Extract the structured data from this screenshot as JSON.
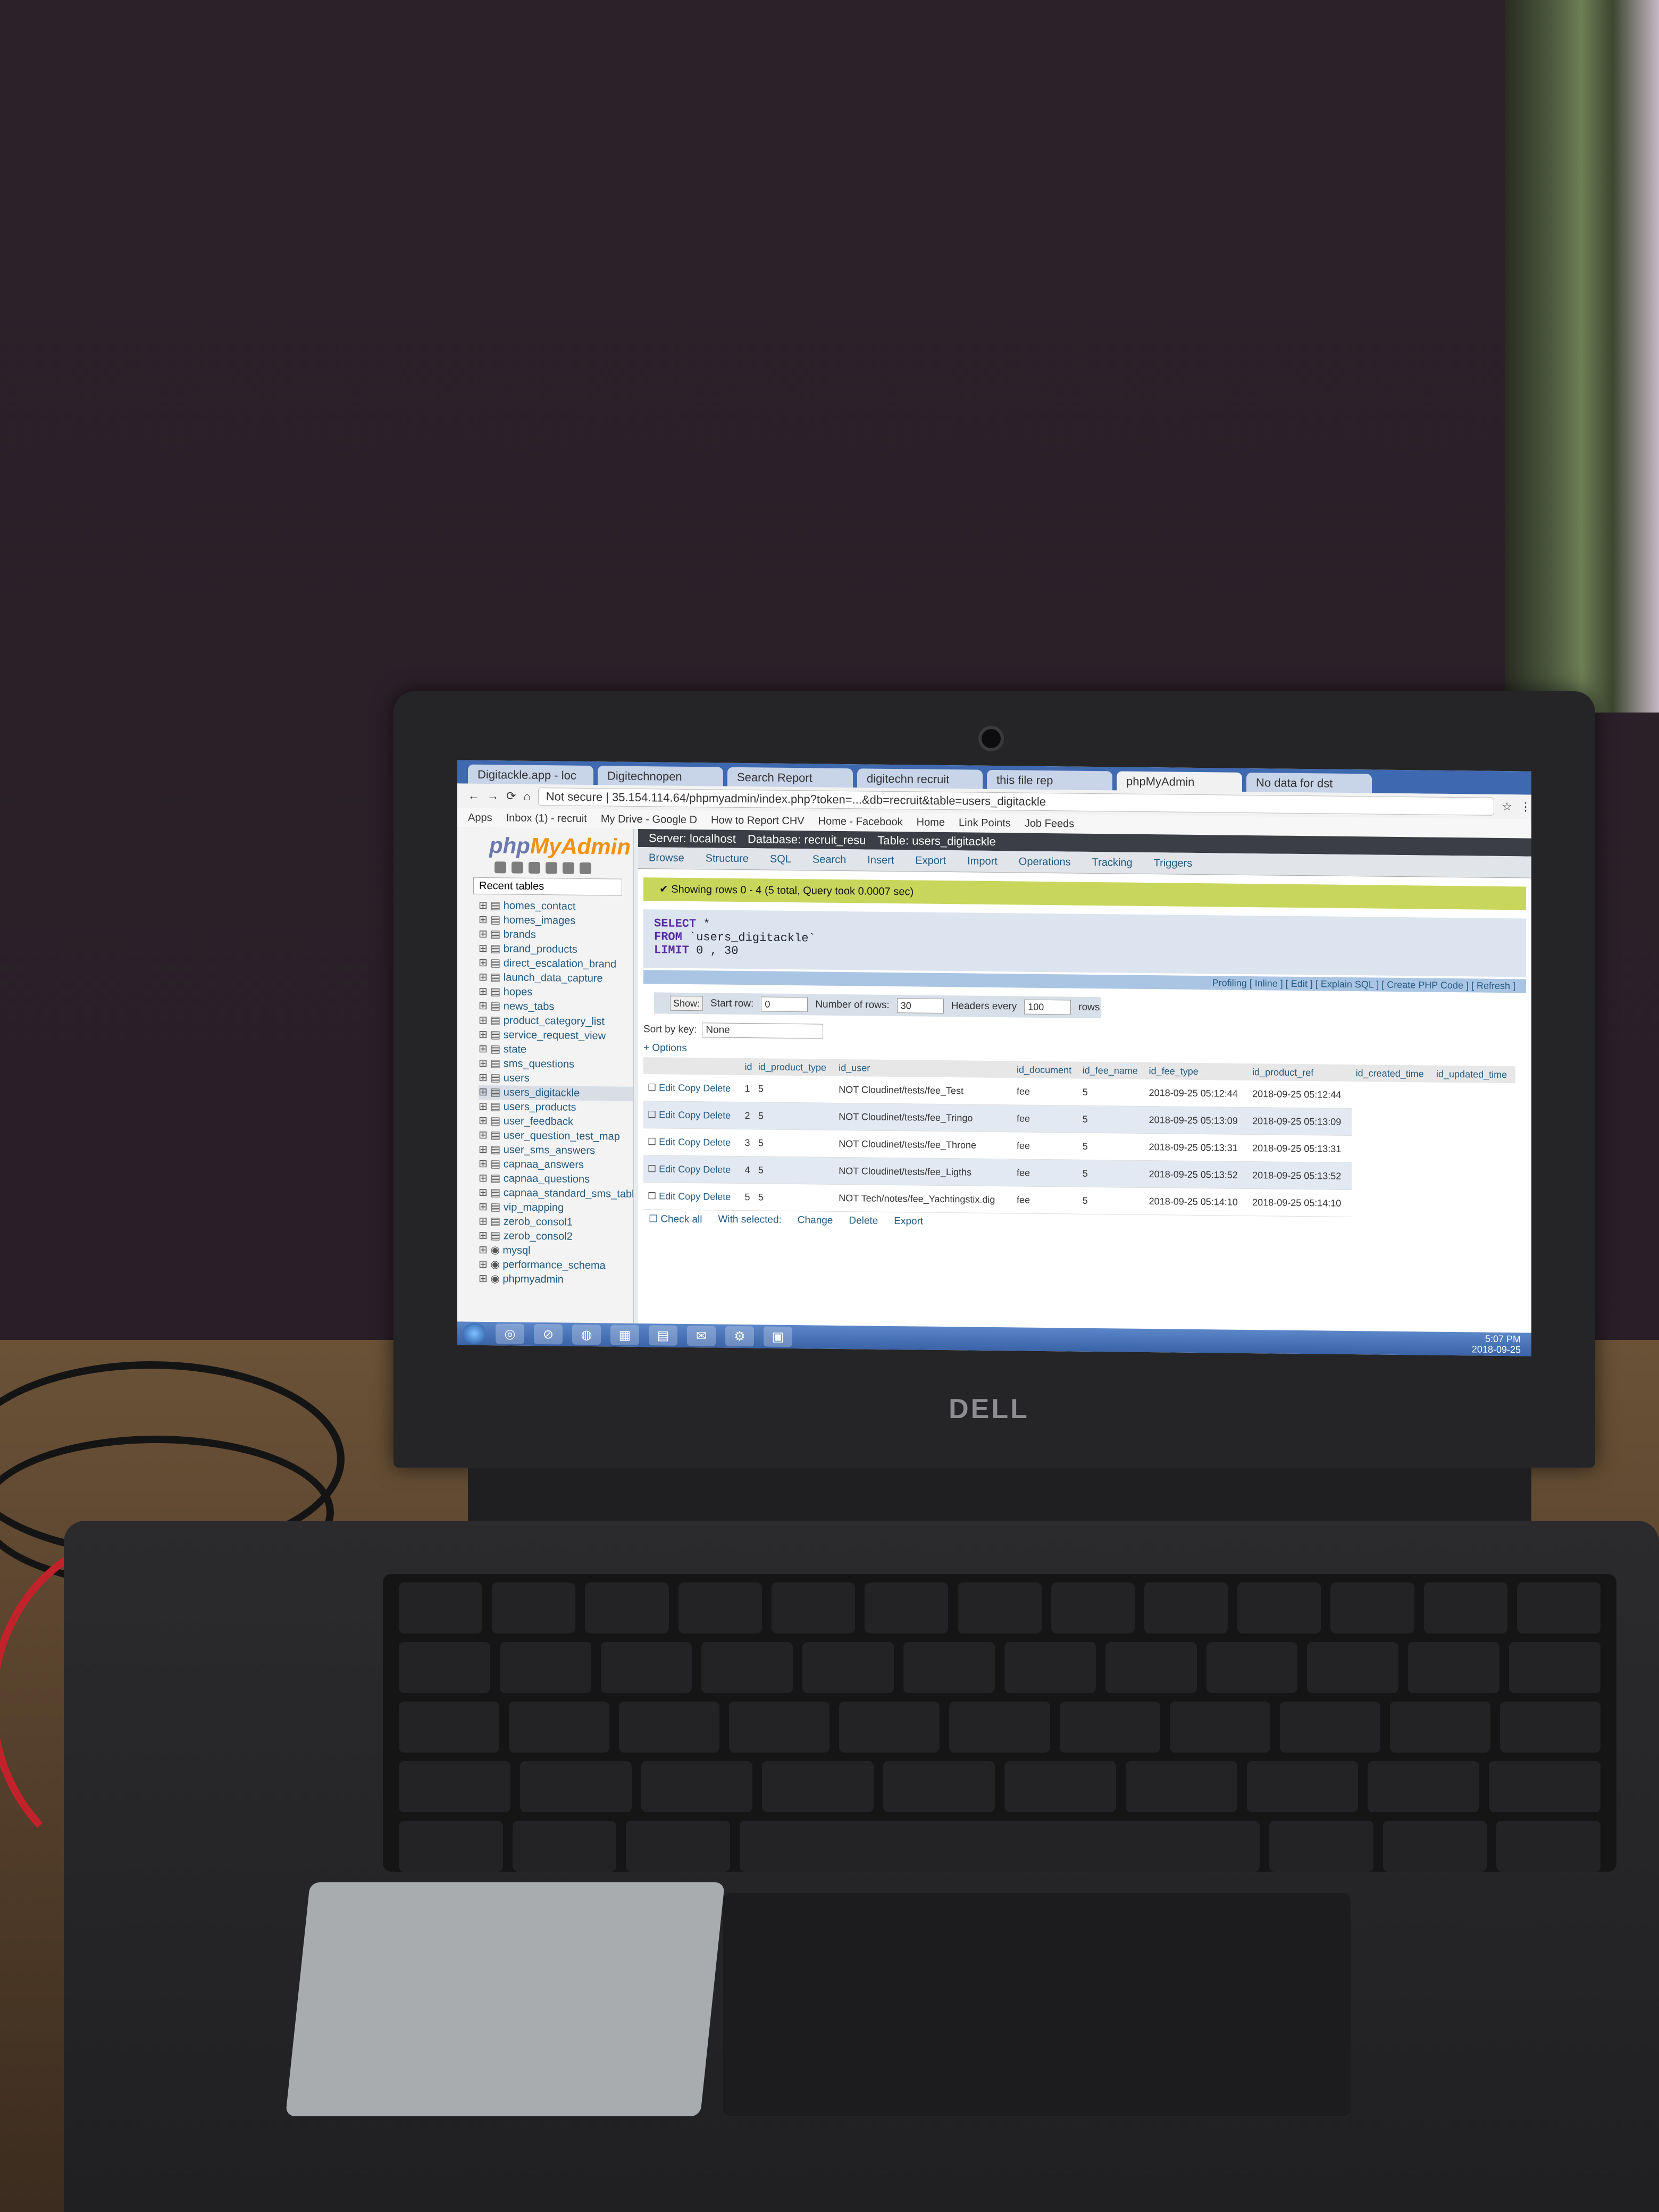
{
  "browser": {
    "tabs": [
      "Digitackle.app - loc",
      "Digitechnopen",
      "Search Report",
      "digitechn recruit",
      "this file rep",
      "phpMyAdmin",
      "No data for dst"
    ],
    "address": "Not secure | 35.154.114.64/phpmyadmin/index.php?token=...&db=recruit&table=users_digitackle",
    "bookmarks": [
      "Apps",
      "Inbox (1) - recruit",
      "My Drive - Google D",
      "How to Report CHV",
      "Home - Facebook",
      "Home",
      "Link Points",
      "Job Feeds"
    ]
  },
  "pma": {
    "logo_php": "php",
    "logo_my": "MyAdmin",
    "recent": "Recent tables",
    "tree": [
      "homes_contact",
      "homes_images",
      "brands",
      "brand_products",
      "direct_escalation_brand",
      "launch_data_capture",
      "hopes",
      "news_tabs",
      "product_category_list",
      "service_request_view",
      "state",
      "sms_questions",
      "users",
      "users_digitackle",
      "users_products",
      "user_feedback",
      "user_question_test_map",
      "user_sms_answers",
      "capnaa_answers",
      "capnaa_questions",
      "capnaa_standard_sms_table",
      "vip_mapping",
      "zerob_consol1",
      "zerob_consol2"
    ],
    "tree_selected": "users_digitackle",
    "databases": [
      "mysql",
      "performance_schema",
      "phpmyadmin"
    ],
    "breadcrumb": [
      "Server: localhost",
      "Database: recruit_resu",
      "Table: users_digitackle"
    ],
    "tabs": [
      "Browse",
      "Structure",
      "SQL",
      "Search",
      "Insert",
      "Export",
      "Import",
      "Operations",
      "Tracking",
      "Triggers"
    ],
    "success": "Showing rows 0 - 4 (5 total, Query took 0.0007 sec)",
    "sql": {
      "select": "SELECT",
      "star": "*",
      "from": "FROM",
      "table": "`users_digitackle`",
      "limit": "LIMIT",
      "range": "0 , 30"
    },
    "sqlfoot": "Profiling [ Inline ] [ Edit ] [ Explain SQL ] [ Create PHP Code ] [ Refresh ]",
    "nav": {
      "show": "Show:",
      "start_label": "Start row:",
      "start": "0",
      "num_label": "Number of rows:",
      "num": "30",
      "headers_label": "Headers every",
      "headers": "100",
      "rows_label": "rows"
    },
    "sort_label": "Sort by key:",
    "sort_value": "None",
    "options": "+ Options",
    "columns": [
      "",
      "id",
      "id_product_type",
      "id_user",
      "id_document",
      "id_fee_name",
      "id_fee_type",
      "id_product_ref",
      "id_created_time",
      "id_updated_time"
    ],
    "row_actions": {
      "edit": "Edit",
      "copy": "Copy",
      "delete": "Delete"
    },
    "rows": [
      [
        "1",
        "5",
        "NOT Cloudinet/tests/fee_Test",
        "fee",
        "5",
        "2018-09-25 05:12:44",
        "2018-09-25 05:12:44"
      ],
      [
        "2",
        "5",
        "NOT Cloudinet/tests/fee_Tringo",
        "fee",
        "5",
        "2018-09-25 05:13:09",
        "2018-09-25 05:13:09"
      ],
      [
        "3",
        "5",
        "NOT Cloudinet/tests/fee_Throne",
        "fee",
        "5",
        "2018-09-25 05:13:31",
        "2018-09-25 05:13:31"
      ],
      [
        "4",
        "5",
        "NOT Cloudinet/tests/fee_Ligths",
        "fee",
        "5",
        "2018-09-25 05:13:52",
        "2018-09-25 05:13:52"
      ],
      [
        "5",
        "5",
        "NOT Tech/notes/fee_Yachtingstix.dig",
        "fee",
        "5",
        "2018-09-25 05:14:10",
        "2018-09-25 05:14:10"
      ]
    ],
    "bulk": {
      "check_all": "Check all",
      "with_selected": "With selected:",
      "change": "Change",
      "delete": "Delete",
      "export": "Export"
    }
  },
  "taskbar": {
    "icons": [
      "◎",
      "⊘",
      "◍",
      "▦",
      "▤",
      "✉",
      "⚙",
      "▣"
    ],
    "time": "5:07 PM",
    "date": "2018-09-25"
  },
  "laptop": {
    "brand": "DELL"
  }
}
